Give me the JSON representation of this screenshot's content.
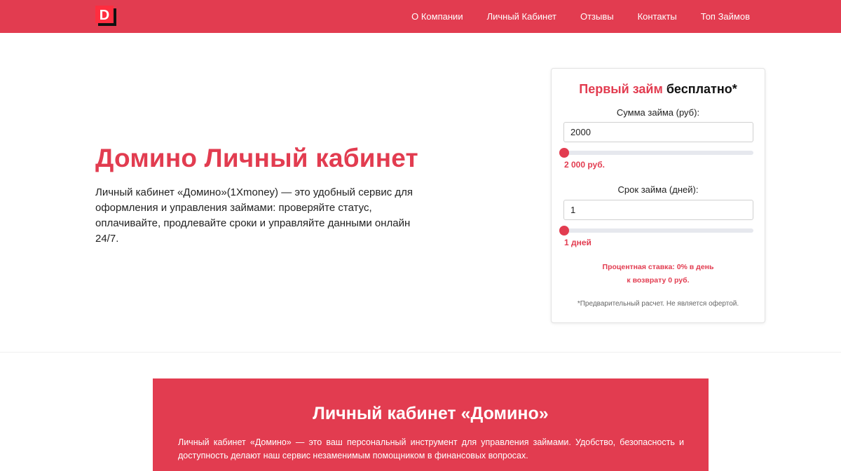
{
  "brand": {
    "logo_letter": "D",
    "colors": {
      "accent": "#e23c50",
      "text": "#222222"
    }
  },
  "nav": {
    "items": [
      {
        "label": "О Компании"
      },
      {
        "label": "Личный Кабинет"
      },
      {
        "label": "Отзывы"
      },
      {
        "label": "Контакты"
      },
      {
        "label": "Топ Займов"
      }
    ]
  },
  "hero": {
    "title": "Домино Личный кабинет",
    "description": "Личный кабинет «Домино»(1Xmoney) — это удобный сервис для оформления и управления займами: проверяйте статус, оплачивайте, продлевайте сроки и управляйте данными онлайн 24/7."
  },
  "calculator": {
    "title_accent": "Первый займ",
    "title_rest": " бесплатно*",
    "amount_label": "Сумма займа (руб):",
    "amount_value": "2000",
    "amount_display": "2 000 руб.",
    "amount_slider_fraction": 0,
    "term_label": "Срок займа (дней):",
    "term_value": "1",
    "term_display": "1 дней",
    "term_slider_fraction": 0,
    "rate_line": "Процентная ставка: 0% в день",
    "return_line": "к возврату 0 руб.",
    "note": "*Предварительный расчет. Не является офертой."
  },
  "info": {
    "title": "Личный кабинет «Домино»",
    "text": "Личный кабинет «Домино» — это ваш персональный инструмент для управления займами. Удобство, безопасность и доступность делают наш сервис незаменимым помощником в финансовых вопросах."
  }
}
